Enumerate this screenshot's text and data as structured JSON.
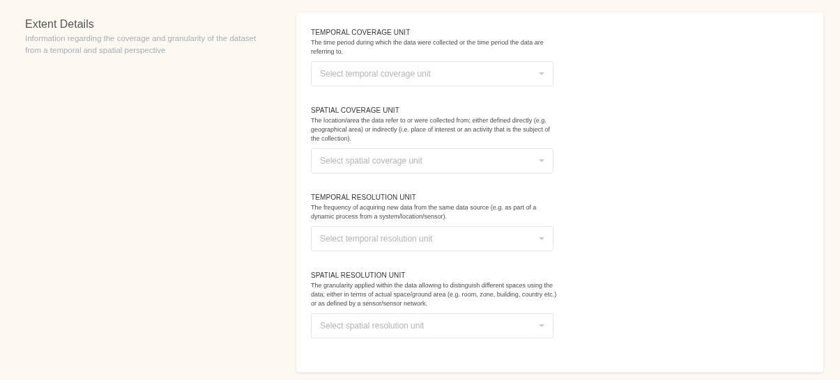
{
  "section": {
    "title": "Extent Details",
    "description": "Information regarding the coverage and granularity of the dataset from a temporal and spatial perspective"
  },
  "fields": [
    {
      "label": "TEMPORAL COVERAGE UNIT",
      "description": "The time period during which the data were collected or the time period the data are referring to.",
      "placeholder": "Select temporal coverage unit"
    },
    {
      "label": "SPATIAL COVERAGE UNIT",
      "description": "The location/area the data refer to or were collected from; either defined directly (e.g. geographical area) or indirectly (i.e. place of interest or an activity that is the subject of the collection).",
      "placeholder": "Select spatial coverage unit"
    },
    {
      "label": "TEMPORAL RESOLUTION UNIT",
      "description": "The frequency of acquiring new data from the same data source (e.g. as part of a dynamic process from a system/location/sensor).",
      "placeholder": "Select temporal resolution unit"
    },
    {
      "label": "SPATIAL RESOLUTION UNIT",
      "description": "The granularity applied within the data allowing to distinguish different spaces using the data; either in terms of actual space/ground area (e.g. room, zone, building, country etc.) or as defined by a sensor/sensor network.",
      "placeholder": "Select spatial resolution unit"
    }
  ]
}
